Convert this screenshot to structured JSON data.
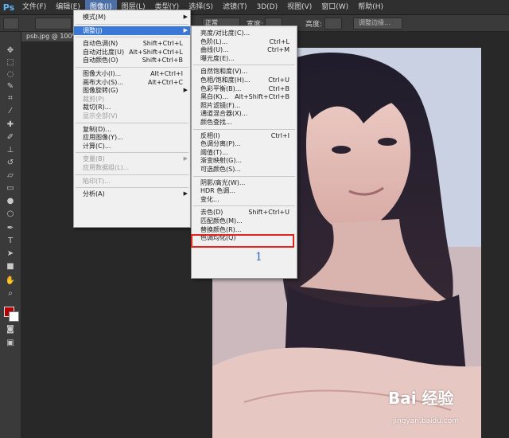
{
  "app": {
    "logo": "Ps"
  },
  "menubar": {
    "items": [
      "文件(F)",
      "编辑(E)",
      "图像(I)",
      "图层(L)",
      "类型(Y)",
      "选择(S)",
      "滤镜(T)",
      "3D(D)",
      "视图(V)",
      "窗口(W)",
      "帮助(H)"
    ],
    "active_index": 2
  },
  "options": {
    "mode_value": "正常",
    "opacity_label": "宽度:",
    "height_label": "高度:",
    "adjust_edge": "调整边缘..."
  },
  "document": {
    "tab_title": "psb.jpg @ 100%(RGB/8)"
  },
  "image_menu": {
    "items": [
      {
        "label": "模式(M)",
        "submenu": true
      },
      {
        "sep": true
      },
      {
        "label": "调整(J)",
        "submenu": true,
        "highlight": true
      },
      {
        "sep": true
      },
      {
        "label": "自动色调(N)",
        "shortcut": "Shift+Ctrl+L"
      },
      {
        "label": "自动对比度(U)",
        "shortcut": "Alt+Shift+Ctrl+L"
      },
      {
        "label": "自动颜色(O)",
        "shortcut": "Shift+Ctrl+B"
      },
      {
        "sep": true
      },
      {
        "label": "图像大小(I)...",
        "shortcut": "Alt+Ctrl+I"
      },
      {
        "label": "画布大小(S)...",
        "shortcut": "Alt+Ctrl+C"
      },
      {
        "label": "图像旋转(G)",
        "submenu": true
      },
      {
        "label": "裁剪(P)",
        "disabled": true
      },
      {
        "label": "裁切(R)..."
      },
      {
        "label": "显示全部(V)",
        "disabled": true
      },
      {
        "sep": true
      },
      {
        "label": "复制(D)..."
      },
      {
        "label": "应用图像(Y)..."
      },
      {
        "label": "计算(C)..."
      },
      {
        "sep": true
      },
      {
        "label": "变量(B)",
        "submenu": true,
        "disabled": true
      },
      {
        "label": "应用数据组(L)...",
        "disabled": true
      },
      {
        "sep": true
      },
      {
        "label": "陷印(T)...",
        "disabled": true
      },
      {
        "sep": true
      },
      {
        "label": "分析(A)",
        "submenu": true
      }
    ]
  },
  "adjust_menu": {
    "items": [
      {
        "label": "亮度/对比度(C)..."
      },
      {
        "label": "色阶(L)...",
        "shortcut": "Ctrl+L"
      },
      {
        "label": "曲线(U)...",
        "shortcut": "Ctrl+M"
      },
      {
        "label": "曝光度(E)..."
      },
      {
        "sep": true
      },
      {
        "label": "自然饱和度(V)..."
      },
      {
        "label": "色相/饱和度(H)...",
        "shortcut": "Ctrl+U"
      },
      {
        "label": "色彩平衡(B)...",
        "shortcut": "Ctrl+B"
      },
      {
        "label": "黑白(K)...",
        "shortcut": "Alt+Shift+Ctrl+B"
      },
      {
        "label": "照片滤镜(F)..."
      },
      {
        "label": "通道混合器(X)..."
      },
      {
        "label": "颜色查找..."
      },
      {
        "sep": true
      },
      {
        "label": "反相(I)",
        "shortcut": "Ctrl+I"
      },
      {
        "label": "色调分离(P)..."
      },
      {
        "label": "阈值(T)..."
      },
      {
        "label": "渐变映射(G)..."
      },
      {
        "label": "可选颜色(S)..."
      },
      {
        "sep": true
      },
      {
        "label": "阴影/高光(W)..."
      },
      {
        "label": "HDR 色调..."
      },
      {
        "label": "变化..."
      },
      {
        "sep": true
      },
      {
        "label": "去色(D)",
        "shortcut": "Shift+Ctrl+U"
      },
      {
        "label": "匹配颜色(M)..."
      },
      {
        "label": "替换颜色(R)..."
      },
      {
        "label": "色调均化(Q)"
      }
    ]
  },
  "annotation": {
    "step": "1"
  },
  "watermark": {
    "logo": "Bai 经验",
    "url": "jingyan.baidu.com"
  },
  "colors": {
    "menu_highlight": "#3a77d6",
    "annotation_box": "#e3231d",
    "step_number": "#3566c0"
  }
}
